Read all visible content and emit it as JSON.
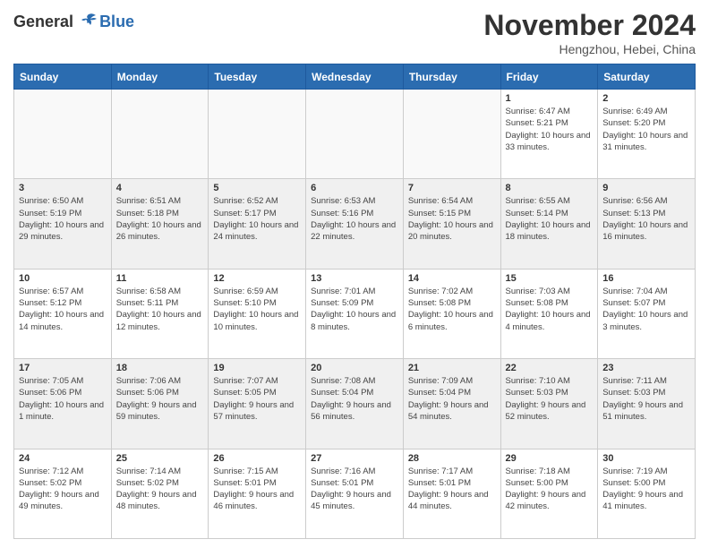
{
  "header": {
    "logo_line1": "General",
    "logo_line2": "Blue",
    "month": "November 2024",
    "location": "Hengzhou, Hebei, China"
  },
  "weekdays": [
    "Sunday",
    "Monday",
    "Tuesday",
    "Wednesday",
    "Thursday",
    "Friday",
    "Saturday"
  ],
  "weeks": [
    [
      {
        "day": "",
        "info": "",
        "empty": true
      },
      {
        "day": "",
        "info": "",
        "empty": true
      },
      {
        "day": "",
        "info": "",
        "empty": true
      },
      {
        "day": "",
        "info": "",
        "empty": true
      },
      {
        "day": "",
        "info": "",
        "empty": true
      },
      {
        "day": "1",
        "info": "Sunrise: 6:47 AM\nSunset: 5:21 PM\nDaylight: 10 hours and 33 minutes."
      },
      {
        "day": "2",
        "info": "Sunrise: 6:49 AM\nSunset: 5:20 PM\nDaylight: 10 hours and 31 minutes."
      }
    ],
    [
      {
        "day": "3",
        "info": "Sunrise: 6:50 AM\nSunset: 5:19 PM\nDaylight: 10 hours and 29 minutes."
      },
      {
        "day": "4",
        "info": "Sunrise: 6:51 AM\nSunset: 5:18 PM\nDaylight: 10 hours and 26 minutes."
      },
      {
        "day": "5",
        "info": "Sunrise: 6:52 AM\nSunset: 5:17 PM\nDaylight: 10 hours and 24 minutes."
      },
      {
        "day": "6",
        "info": "Sunrise: 6:53 AM\nSunset: 5:16 PM\nDaylight: 10 hours and 22 minutes."
      },
      {
        "day": "7",
        "info": "Sunrise: 6:54 AM\nSunset: 5:15 PM\nDaylight: 10 hours and 20 minutes."
      },
      {
        "day": "8",
        "info": "Sunrise: 6:55 AM\nSunset: 5:14 PM\nDaylight: 10 hours and 18 minutes."
      },
      {
        "day": "9",
        "info": "Sunrise: 6:56 AM\nSunset: 5:13 PM\nDaylight: 10 hours and 16 minutes."
      }
    ],
    [
      {
        "day": "10",
        "info": "Sunrise: 6:57 AM\nSunset: 5:12 PM\nDaylight: 10 hours and 14 minutes."
      },
      {
        "day": "11",
        "info": "Sunrise: 6:58 AM\nSunset: 5:11 PM\nDaylight: 10 hours and 12 minutes."
      },
      {
        "day": "12",
        "info": "Sunrise: 6:59 AM\nSunset: 5:10 PM\nDaylight: 10 hours and 10 minutes."
      },
      {
        "day": "13",
        "info": "Sunrise: 7:01 AM\nSunset: 5:09 PM\nDaylight: 10 hours and 8 minutes."
      },
      {
        "day": "14",
        "info": "Sunrise: 7:02 AM\nSunset: 5:08 PM\nDaylight: 10 hours and 6 minutes."
      },
      {
        "day": "15",
        "info": "Sunrise: 7:03 AM\nSunset: 5:08 PM\nDaylight: 10 hours and 4 minutes."
      },
      {
        "day": "16",
        "info": "Sunrise: 7:04 AM\nSunset: 5:07 PM\nDaylight: 10 hours and 3 minutes."
      }
    ],
    [
      {
        "day": "17",
        "info": "Sunrise: 7:05 AM\nSunset: 5:06 PM\nDaylight: 10 hours and 1 minute."
      },
      {
        "day": "18",
        "info": "Sunrise: 7:06 AM\nSunset: 5:06 PM\nDaylight: 9 hours and 59 minutes."
      },
      {
        "day": "19",
        "info": "Sunrise: 7:07 AM\nSunset: 5:05 PM\nDaylight: 9 hours and 57 minutes."
      },
      {
        "day": "20",
        "info": "Sunrise: 7:08 AM\nSunset: 5:04 PM\nDaylight: 9 hours and 56 minutes."
      },
      {
        "day": "21",
        "info": "Sunrise: 7:09 AM\nSunset: 5:04 PM\nDaylight: 9 hours and 54 minutes."
      },
      {
        "day": "22",
        "info": "Sunrise: 7:10 AM\nSunset: 5:03 PM\nDaylight: 9 hours and 52 minutes."
      },
      {
        "day": "23",
        "info": "Sunrise: 7:11 AM\nSunset: 5:03 PM\nDaylight: 9 hours and 51 minutes."
      }
    ],
    [
      {
        "day": "24",
        "info": "Sunrise: 7:12 AM\nSunset: 5:02 PM\nDaylight: 9 hours and 49 minutes."
      },
      {
        "day": "25",
        "info": "Sunrise: 7:14 AM\nSunset: 5:02 PM\nDaylight: 9 hours and 48 minutes."
      },
      {
        "day": "26",
        "info": "Sunrise: 7:15 AM\nSunset: 5:01 PM\nDaylight: 9 hours and 46 minutes."
      },
      {
        "day": "27",
        "info": "Sunrise: 7:16 AM\nSunset: 5:01 PM\nDaylight: 9 hours and 45 minutes."
      },
      {
        "day": "28",
        "info": "Sunrise: 7:17 AM\nSunset: 5:01 PM\nDaylight: 9 hours and 44 minutes."
      },
      {
        "day": "29",
        "info": "Sunrise: 7:18 AM\nSunset: 5:00 PM\nDaylight: 9 hours and 42 minutes."
      },
      {
        "day": "30",
        "info": "Sunrise: 7:19 AM\nSunset: 5:00 PM\nDaylight: 9 hours and 41 minutes."
      }
    ]
  ]
}
